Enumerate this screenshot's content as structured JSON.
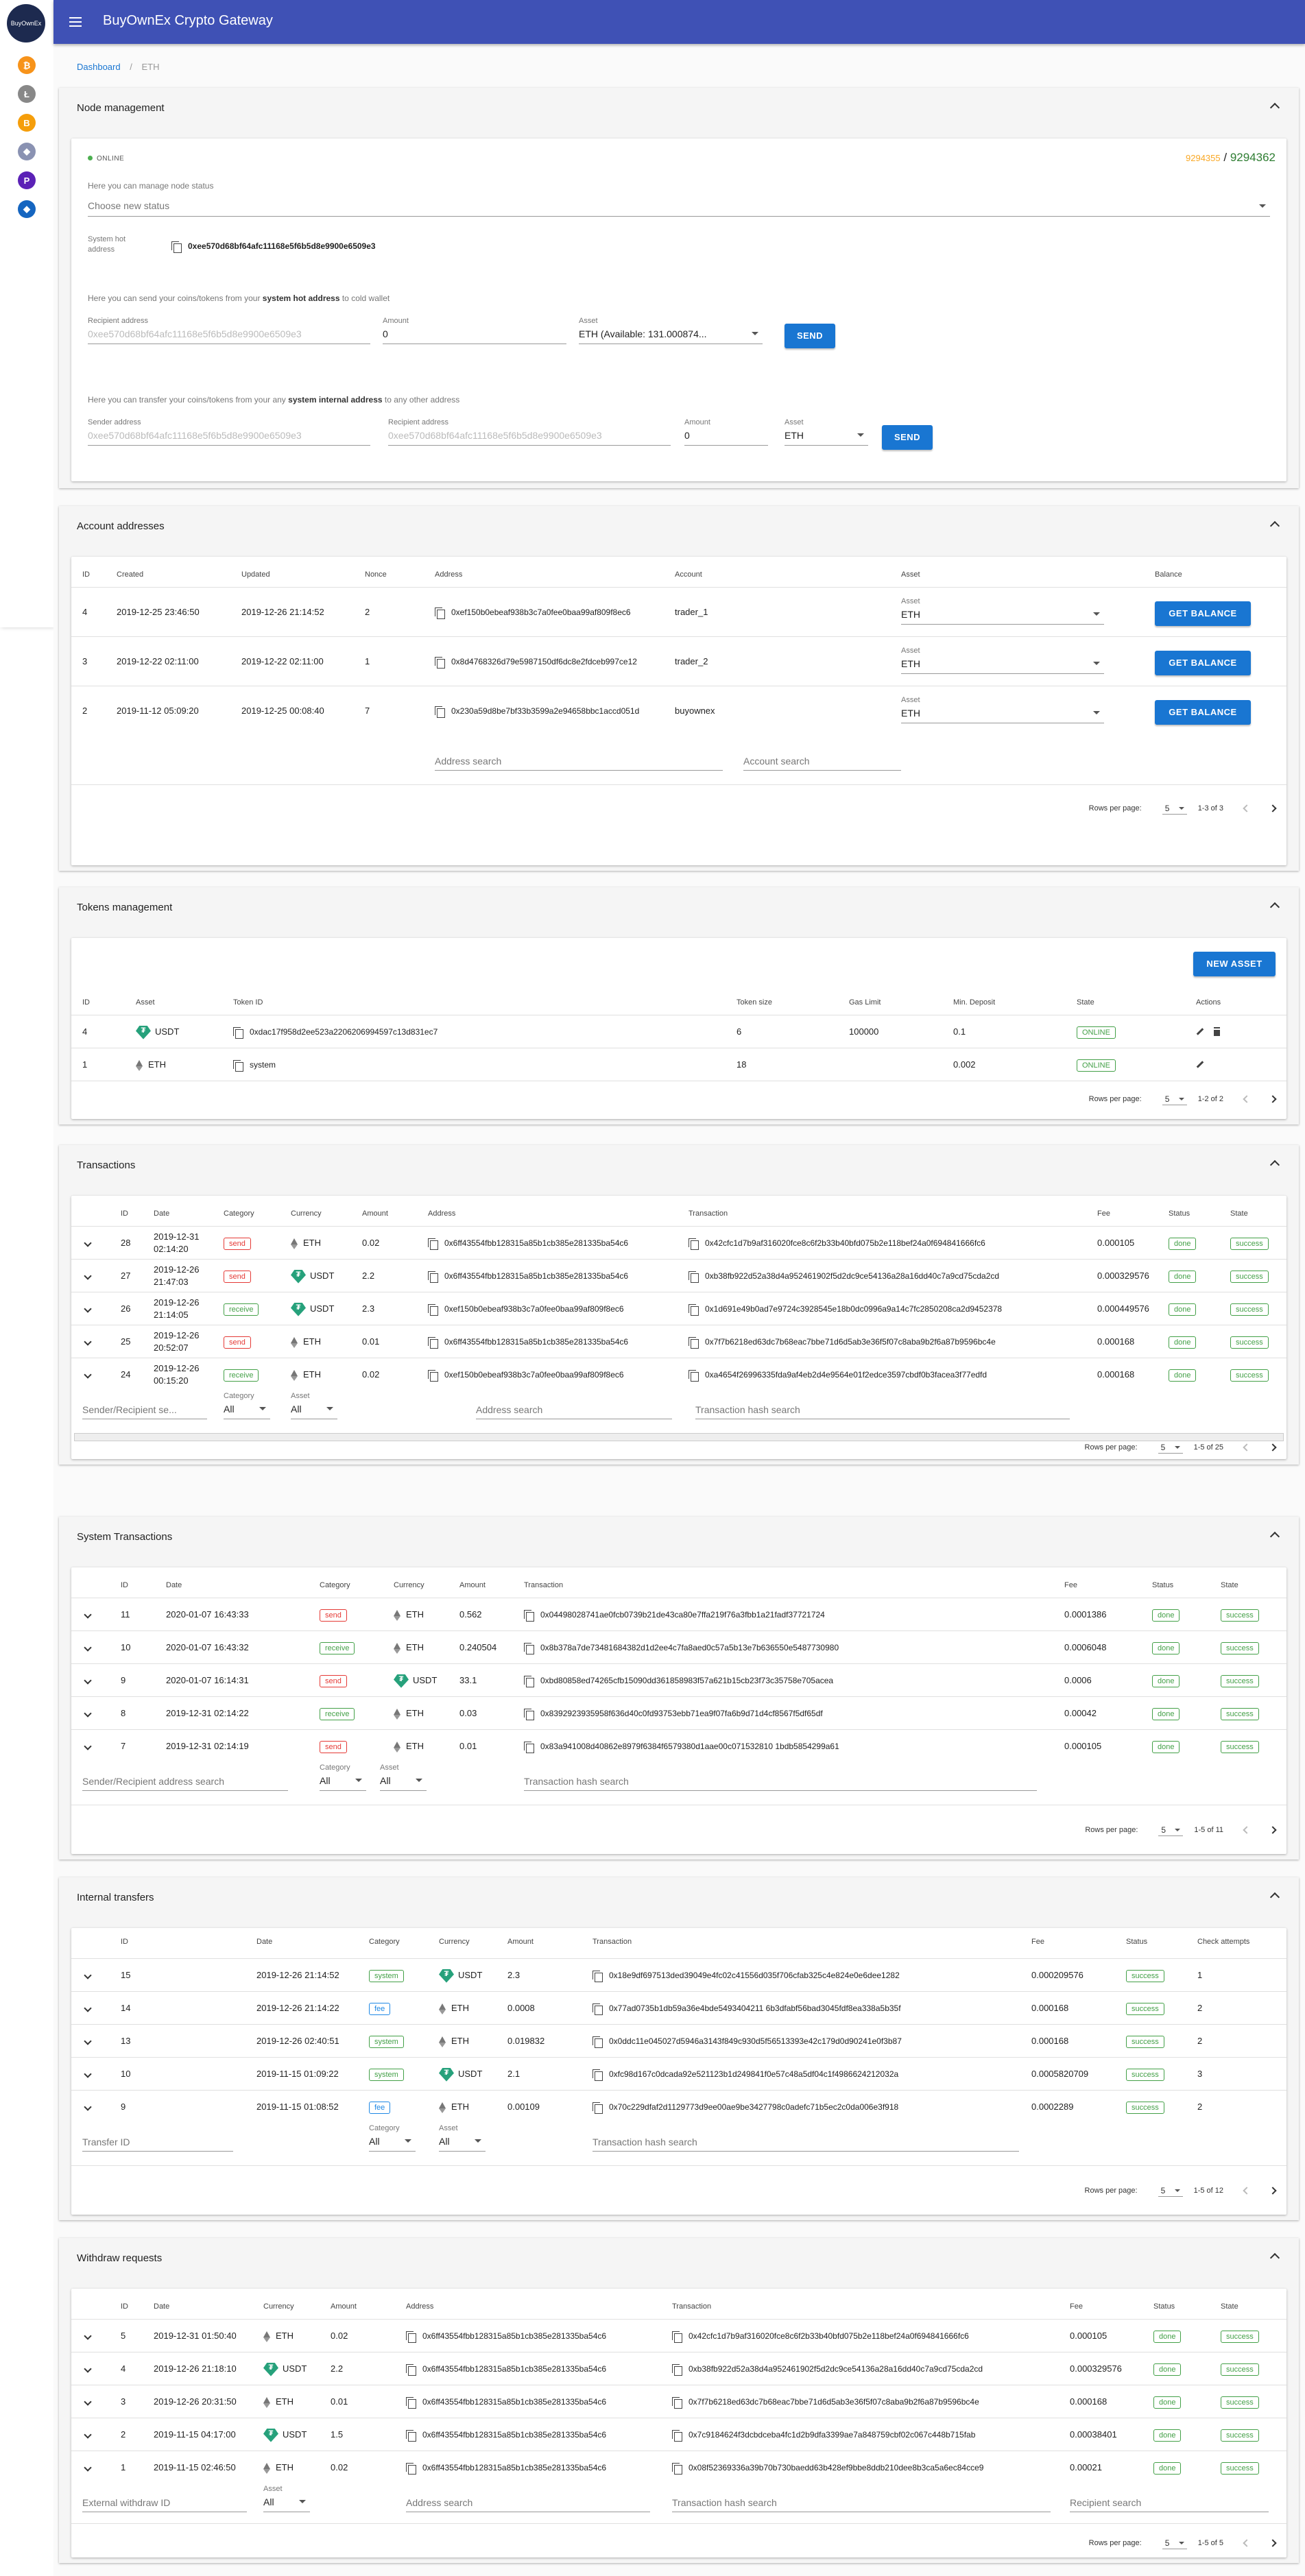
{
  "app": {
    "title": "BuyOwnEx Crypto Gateway",
    "logo": "BuyOwnEx"
  },
  "rail": {
    "icons": [
      {
        "n": "btc-icon",
        "c": "#f7931a",
        "t": "₿"
      },
      {
        "n": "ltc-icon",
        "c": "#888",
        "t": "Ł"
      },
      {
        "n": "bch-icon",
        "c": "#f59e0b",
        "t": "B"
      },
      {
        "n": "eth-icon",
        "c": "#8a92b2",
        "t": "◆"
      },
      {
        "n": "pay-icon",
        "c": "#5b21b6",
        "t": "P"
      },
      {
        "n": "bnb-icon",
        "c": "#1565c0",
        "t": "◆"
      }
    ]
  },
  "breadcrumb": {
    "home": "Dashboard",
    "sep": "/",
    "current": "ETH"
  },
  "node": {
    "title": "Node management",
    "status": "ONLINE",
    "block_a": "9294355",
    "block_sep": " / ",
    "block_b": "9294362",
    "manage_label": "Here you can manage node status",
    "choose_status": "Choose new status",
    "hot_label": "System hot address",
    "hot_address": "0xee570d68bf64afc11168e5f6b5d8e9900e6509e3",
    "send_text_pre": "Here you can send your coins/tokens from your ",
    "send_text_bold": "system hot address",
    "send_text_post": " to cold wallet",
    "recipient_label": "Recipient address",
    "recipient_ph": "0xee570d68bf64afc11168e5f6b5d8e9900e6509e3",
    "amount_label": "Amount",
    "amount_val": "0",
    "asset_label": "Asset",
    "asset_val": "ETH (Available: 131.000874...",
    "send_btn": "SEND",
    "transfer_text_pre": "Here you can transfer your coins/tokens from your any ",
    "transfer_text_bold": "system internal address",
    "transfer_text_post": " to any other address",
    "sender_label": "Sender address",
    "sender_ph": "0xee570d68bf64afc11168e5f6b5d8e9900e6509e3",
    "recipient2_label": "Recipient address",
    "recipient2_ph": "0xee570d68bf64afc11168e5f6b5d8e9900e6509e3",
    "amount2_label": "Amount",
    "amount2_val": "0",
    "asset2_label": "Asset",
    "asset2_val": "ETH",
    "send2_btn": "SEND"
  },
  "accounts": {
    "title": "Account addresses",
    "headers": [
      "ID",
      "Created",
      "Updated",
      "Nonce",
      "Address",
      "Account",
      "Asset",
      "Balance"
    ],
    "rows": [
      {
        "id": "4",
        "created": "2019-12-25 23:46:50",
        "updated": "2019-12-26 21:14:52",
        "nonce": "2",
        "address": "0xef150b0ebeaf938b3c7a0fee0baa99af809f8ec6",
        "account": "trader_1",
        "asset_label": "Asset",
        "asset": "ETH",
        "btn": "GET BALANCE"
      },
      {
        "id": "3",
        "created": "2019-12-22 02:11:00",
        "updated": "2019-12-22 02:11:00",
        "nonce": "1",
        "address": "0x8d4768326d79e5987150df6dc8e2fdceb997ce12",
        "account": "trader_2",
        "asset_label": "Asset",
        "asset": "ETH",
        "btn": "GET BALANCE"
      },
      {
        "id": "2",
        "created": "2019-11-12 05:09:20",
        "updated": "2019-12-25 00:08:40",
        "nonce": "7",
        "address": "0x230a59d8be7bf33b3599a2e94658bbc1accd051d",
        "account": "buyownex",
        "asset_label": "Asset",
        "asset": "ETH",
        "btn": "GET BALANCE"
      }
    ],
    "address_search": "Address search",
    "account_search": "Account search",
    "rpp_label": "Rows per page:",
    "rpp": "5",
    "range": "1-3 of 3"
  },
  "tokens": {
    "title": "Tokens management",
    "new_btn": "NEW ASSET",
    "headers": [
      "ID",
      "Asset",
      "Token ID",
      "Token size",
      "Gas Limit",
      "Min. Deposit",
      "State",
      "Actions"
    ],
    "rows": [
      {
        "id": "4",
        "asset": "USDT",
        "token_id": "0xdac17f958d2ee523a2206206994597c13d831ec7",
        "size": "6",
        "gas": "100000",
        "min": "0.1",
        "state": "ONLINE"
      },
      {
        "id": "1",
        "asset": "ETH",
        "token_id": "system",
        "size": "18",
        "gas": "",
        "min": "0.002",
        "state": "ONLINE"
      }
    ],
    "rpp_label": "Rows per page:",
    "rpp": "5",
    "range": "1-2 of 2"
  },
  "transactions": {
    "title": "Transactions",
    "headers": [
      "ID",
      "Date",
      "Category",
      "Currency",
      "Amount",
      "Address",
      "Transaction",
      "Fee",
      "Status",
      "State"
    ],
    "rows": [
      {
        "id": "28",
        "date": "2019-12-31 02:14:20",
        "cat": "send",
        "cur": "ETH",
        "amount": "0.02",
        "address": "0x6ff43554fbb128315a85b1cb385e281335ba54c6",
        "tx": "0x42cfc1d7b9af316020fce8c6f2b33b40bfd075b2e118bef24a0f694841666fc6",
        "fee": "0.000105",
        "status": "done",
        "state": "success"
      },
      {
        "id": "27",
        "date": "2019-12-26 21:47:03",
        "cat": "send",
        "cur": "USDT",
        "amount": "2.2",
        "address": "0x6ff43554fbb128315a85b1cb385e281335ba54c6",
        "tx": "0xb38fb922d52a38d4a952461902f5d2dc9ce54136a28a16dd40c7a9cd75cda2cd",
        "fee": "0.000329576",
        "status": "done",
        "state": "success"
      },
      {
        "id": "26",
        "date": "2019-12-26 21:14:05",
        "cat": "receive",
        "cur": "USDT",
        "amount": "2.3",
        "address": "0xef150b0ebeaf938b3c7a0fee0baa99af809f8ec6",
        "tx": "0x1d691e49b0ad7e9724c3928545e18b0dc0996a9a14c7fc2850208ca2d9452378",
        "fee": "0.000449576",
        "status": "done",
        "state": "success"
      },
      {
        "id": "25",
        "date": "2019-12-26 20:52:07",
        "cat": "send",
        "cur": "ETH",
        "amount": "0.01",
        "address": "0x6ff43554fbb128315a85b1cb385e281335ba54c6",
        "tx": "0x7f7b6218ed63dc7b68eac7bbe71d6d5ab3e36f5f07c8aba9b2f6a87b9596bc4e",
        "fee": "0.000168",
        "status": "done",
        "state": "success"
      },
      {
        "id": "24",
        "date": "2019-12-26 00:15:20",
        "cat": "receive",
        "cur": "ETH",
        "amount": "0.02",
        "address": "0xef150b0ebeaf938b3c7a0fee0baa99af809f8ec6",
        "tx": "0xa4654f26996335fda9af4eb2d4e9564e01f2edce3597cbdf0b3facea3f77edfd",
        "fee": "0.000168",
        "status": "done",
        "state": "success"
      }
    ],
    "f_sender": "Sender/Recipient se...",
    "f_cat_label": "Category",
    "f_cat": "All",
    "f_asset_label": "Asset",
    "f_asset": "All",
    "f_addr": "Address search",
    "f_tx": "Transaction hash search",
    "rpp_label": "Rows per page:",
    "rpp": "5",
    "range": "1-5 of 25"
  },
  "systx": {
    "title": "System Transactions",
    "headers": [
      "ID",
      "Date",
      "Category",
      "Currency",
      "Amount",
      "Transaction",
      "Fee",
      "Status",
      "State"
    ],
    "rows": [
      {
        "id": "11",
        "date": "2020-01-07 16:43:33",
        "cat": "send",
        "cur": "ETH",
        "amount": "0.562",
        "tx": "0x04498028741ae0fcb0739b21de43ca80e7ffa219f76a3fbb1a21fadf37721724",
        "fee": "0.0001386",
        "status": "done",
        "state": "success"
      },
      {
        "id": "10",
        "date": "2020-01-07 16:43:32",
        "cat": "receive",
        "cur": "ETH",
        "amount": "0.240504",
        "tx": "0x8b378a7de73481684382d1d2ee4c7fa8aed0c57a5b13e7b636550e5487730980",
        "fee": "0.0006048",
        "status": "done",
        "state": "success"
      },
      {
        "id": "9",
        "date": "2020-01-07 16:14:31",
        "cat": "send",
        "cur": "USDT",
        "amount": "33.1",
        "tx": "0xbd80858ed74265cfb15090dd361858983f57a621b15cb23f73c35758e705acea",
        "fee": "0.0006",
        "status": "done",
        "state": "success"
      },
      {
        "id": "8",
        "date": "2019-12-31 02:14:22",
        "cat": "receive",
        "cur": "ETH",
        "amount": "0.03",
        "tx": "0x8392923935958f636d40c0fd93753ebb71ea9f07fa6b9d71d4cf8567f5df65df",
        "fee": "0.00042",
        "status": "done",
        "state": "success"
      },
      {
        "id": "7",
        "date": "2019-12-31 02:14:19",
        "cat": "send",
        "cur": "ETH",
        "amount": "0.01",
        "tx": "0x83a941008d40862e8979f6384f6579380d1aae00c071532810 1bdb5854299a61",
        "fee": "0.000105",
        "status": "done",
        "state": "success"
      }
    ],
    "f_sender": "Sender/Recipient address search",
    "f_cat_label": "Category",
    "f_cat": "All",
    "f_asset_label": "Asset",
    "f_asset": "All",
    "f_tx": "Transaction hash search",
    "rpp_label": "Rows per page:",
    "rpp": "5",
    "range": "1-5 of 11"
  },
  "internal": {
    "title": "Internal transfers",
    "headers": [
      "ID",
      "Date",
      "Category",
      "Currency",
      "Amount",
      "Transaction",
      "Fee",
      "Status",
      "Check attempts"
    ],
    "rows": [
      {
        "id": "15",
        "date": "2019-12-26 21:14:52",
        "cat": "system",
        "cur": "USDT",
        "amount": "2.3",
        "tx": "0x18e9df697513ded39049e4fc02c41556d035f706cfab325c4e824e0e6dee1282",
        "fee": "0.000209576",
        "status": "success",
        "attempts": "1"
      },
      {
        "id": "14",
        "date": "2019-12-26 21:14:22",
        "cat": "fee",
        "cur": "ETH",
        "amount": "0.0008",
        "tx": "0x77ad0735b1db59a36e4bde5493404211 6b3dfabf56bad3045fdf8ea338a5b35f",
        "fee": "0.000168",
        "status": "success",
        "attempts": "2"
      },
      {
        "id": "13",
        "date": "2019-12-26 02:40:51",
        "cat": "system",
        "cur": "ETH",
        "amount": "0.019832",
        "tx": "0x0ddc11e045027d5946a3143f849c930d5f56513393e42c179d0d90241e0f3b87",
        "fee": "0.000168",
        "status": "success",
        "attempts": "2"
      },
      {
        "id": "10",
        "date": "2019-11-15 01:09:22",
        "cat": "system",
        "cur": "USDT",
        "amount": "2.1",
        "tx": "0xfc98d167c0dcada92e521123b1d249841f0e57c48a5df04c1f4986624212032a",
        "fee": "0.0005820709",
        "status": "success",
        "attempts": "3"
      },
      {
        "id": "9",
        "date": "2019-11-15 01:08:52",
        "cat": "fee",
        "cur": "ETH",
        "amount": "0.00109",
        "tx": "0x70c229dfaf2d1129773d9ee00ae9be3427798c0adefc71b5ec2c0da006e3f918",
        "fee": "0.0002289",
        "status": "success",
        "attempts": "2"
      }
    ],
    "f_id": "Transfer ID",
    "f_cat_label": "Category",
    "f_cat": "All",
    "f_asset_label": "Asset",
    "f_asset": "All",
    "f_tx": "Transaction hash search",
    "rpp_label": "Rows per page:",
    "rpp": "5",
    "range": "1-5 of 12"
  },
  "withdraw": {
    "title": "Withdraw requests",
    "headers": [
      "ID",
      "Date",
      "Currency",
      "Amount",
      "Address",
      "Transaction",
      "Fee",
      "Status",
      "State"
    ],
    "rows": [
      {
        "id": "5",
        "date": "2019-12-31 01:50:40",
        "cur": "ETH",
        "amount": "0.02",
        "address": "0x6ff43554fbb128315a85b1cb385e281335ba54c6",
        "tx": "0x42cfc1d7b9af316020fce8c6f2b33b40bfd075b2e118bef24a0f694841666fc6",
        "fee": "0.000105",
        "status": "done",
        "state": "success"
      },
      {
        "id": "4",
        "date": "2019-12-26 21:18:10",
        "cur": "USDT",
        "amount": "2.2",
        "address": "0x6ff43554fbb128315a85b1cb385e281335ba54c6",
        "tx": "0xb38fb922d52a38d4a952461902f5d2dc9ce54136a28a16dd40c7a9cd75cda2cd",
        "fee": "0.000329576",
        "status": "done",
        "state": "success"
      },
      {
        "id": "3",
        "date": "2019-12-26 20:31:50",
        "cur": "ETH",
        "amount": "0.01",
        "address": "0x6ff43554fbb128315a85b1cb385e281335ba54c6",
        "tx": "0x7f7b6218ed63dc7b68eac7bbe71d6d5ab3e36f5f07c8aba9b2f6a87b9596bc4e",
        "fee": "0.000168",
        "status": "done",
        "state": "success"
      },
      {
        "id": "2",
        "date": "2019-11-15 04:17:00",
        "cur": "USDT",
        "amount": "1.5",
        "address": "0x6ff43554fbb128315a85b1cb385e281335ba54c6",
        "tx": "0x7c9184624f3dcbdceba4fc1d2b9dfa3399ae7a848759cbf02c067c448b715fab",
        "fee": "0.00038401",
        "status": "done",
        "state": "success"
      },
      {
        "id": "1",
        "date": "2019-11-15 02:46:50",
        "cur": "ETH",
        "amount": "0.02",
        "address": "0x6ff43554fbb128315a85b1cb385e281335ba54c6",
        "tx": "0x08f52369336a39b70b730baedd63b428ef9bbe8ddb210dee8b3ca5a6ec84cce9",
        "fee": "0.00021",
        "status": "done",
        "state": "success"
      }
    ],
    "f_id": "External withdraw ID",
    "f_asset_label": "Asset",
    "f_asset": "All",
    "f_addr": "Address search",
    "f_tx": "Transaction hash search",
    "f_rec": "Recipient search",
    "rpp_label": "Rows per page:",
    "rpp": "5",
    "range": "1-5 of 5"
  }
}
